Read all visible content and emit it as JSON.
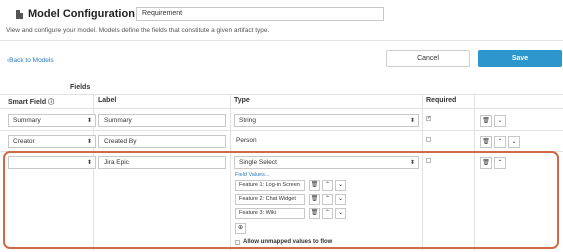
{
  "header": {
    "title": "Model Configuration",
    "model_name": "Requirement"
  },
  "description": "View and configure your model. Models define the fields that constitute a given artifact type.",
  "nav": {
    "back_label": "Back to Models"
  },
  "actions": {
    "cancel_label": "Cancel",
    "save_label": "Save"
  },
  "section_title": "Fields",
  "columns": {
    "smart_field": "Smart Field",
    "label": "Label",
    "type": "Type",
    "required": "Required"
  },
  "rows": [
    {
      "smart_field": "Summary",
      "label": "Summary",
      "type": "String",
      "required": true
    },
    {
      "smart_field": "Creator",
      "label": "Created By",
      "type": "Person",
      "required": false
    },
    {
      "smart_field": "",
      "label": "Jira Epic",
      "type": "Single Select",
      "required": false
    }
  ],
  "field_values": {
    "link_label": "Field Values...",
    "items": [
      "Feature 1: Log-in Screen",
      "Feature 2: Chat Widget",
      "Feature 3: Wiki"
    ],
    "add_icon": "plus-circle-icon",
    "allow_unmapped_label": "Allow unmapped values to flow"
  },
  "icons": {
    "delete": "trash-icon",
    "up": "chevron-up-icon",
    "down": "chevron-down-icon",
    "info": "info-icon"
  },
  "colors": {
    "accent": "#2d96cc",
    "highlight": "#d06a45",
    "link": "#2b7bc0"
  }
}
